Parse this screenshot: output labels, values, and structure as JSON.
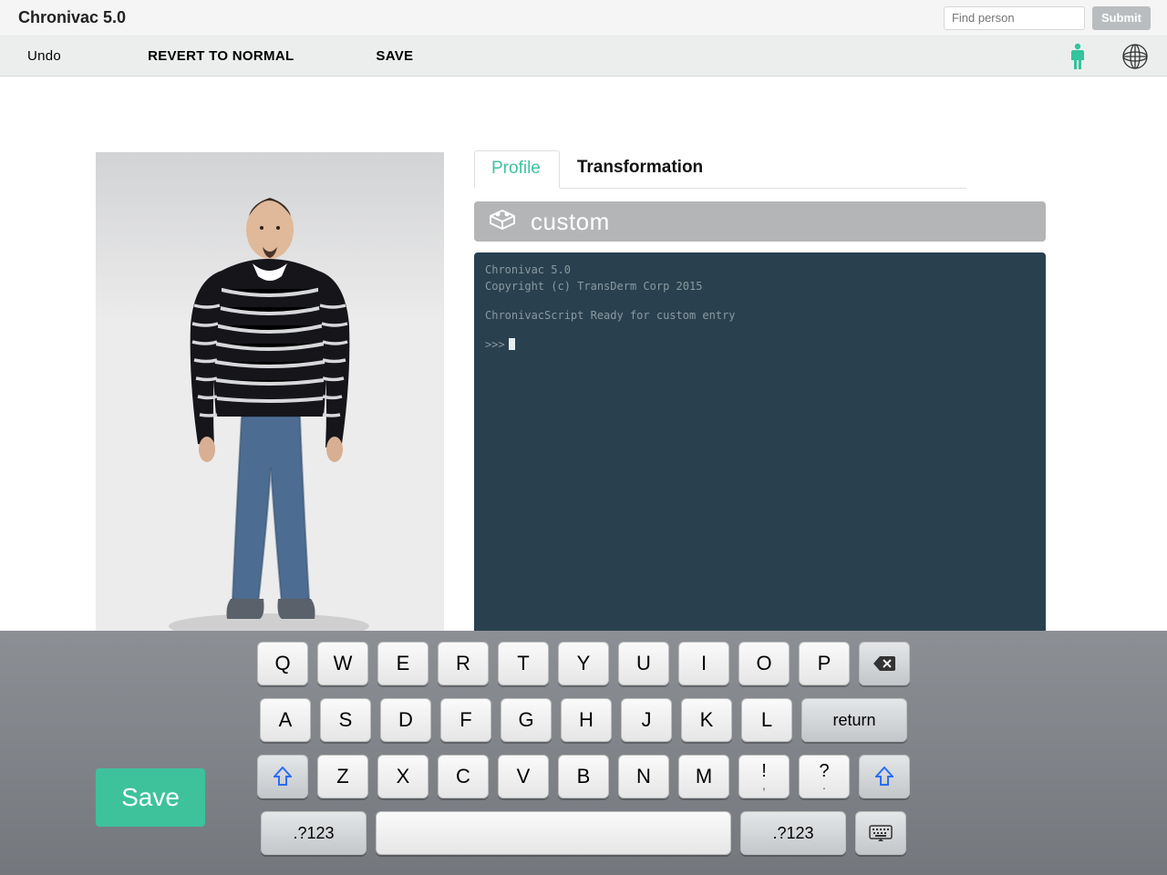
{
  "app": {
    "title": "Chronivac 5.0"
  },
  "search": {
    "placeholder": "Find person",
    "submit_label": "Submit"
  },
  "menu": {
    "undo": "Undo",
    "revert": "REVERT TO NORMAL",
    "save": "SAVE"
  },
  "tabs": {
    "profile": "Profile",
    "transformation": "Transformation"
  },
  "section": {
    "custom": "custom"
  },
  "terminal": {
    "line1": "Chronivac 5.0",
    "line2": "Copyright (c) TransDerm Corp 2015",
    "line3": "ChronivacScript Ready for custom entry",
    "prompt": ">>>"
  },
  "buttons": {
    "save_big": "Save"
  },
  "keyboard": {
    "row1": [
      "Q",
      "W",
      "E",
      "R",
      "T",
      "Y",
      "U",
      "I",
      "O",
      "P"
    ],
    "row2": [
      "A",
      "S",
      "D",
      "F",
      "G",
      "H",
      "J",
      "K",
      "L"
    ],
    "row3": [
      "Z",
      "X",
      "C",
      "V",
      "B",
      "N",
      "M"
    ],
    "return": "return",
    "numsym": ".?123",
    "punct1_top": "!",
    "punct1_bot": ",",
    "punct2_top": "?",
    "punct2_bot": "."
  },
  "colors": {
    "accent": "#3dc29c",
    "terminal_bg": "#29414e"
  }
}
